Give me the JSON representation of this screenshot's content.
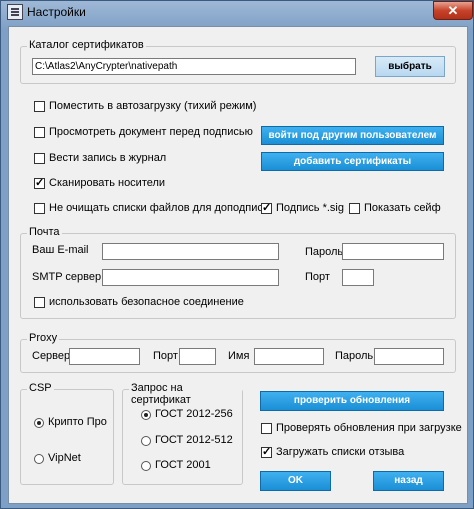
{
  "window": {
    "title": "Настройки",
    "close_glyph": "✕"
  },
  "catalog": {
    "group_title": "Каталог сертификатов",
    "path_value": "C:\\Atlas2\\AnyCrypter\\nativepath",
    "select_button": "выбрать"
  },
  "options": {
    "autostart": {
      "label": "Поместить в автозагрузку (тихий режим)",
      "checked": false
    },
    "preview": {
      "label": "Просмотреть документ перед подписью",
      "checked": false
    },
    "log": {
      "label": "Вести запись в журнал",
      "checked": false
    },
    "scan_media": {
      "label": "Сканировать носители",
      "checked": true
    },
    "keep_lists": {
      "label": "Не очищать списки файлов для доподписи",
      "checked": false
    },
    "signature_sig": {
      "label": "Подпись *.sig",
      "checked": true
    },
    "show_safe": {
      "label": "Показать сейф",
      "checked": false
    }
  },
  "buttons": {
    "login_other": "войти под другим пользователем",
    "add_certs": "добавить сертификаты",
    "check_updates": "проверить обновления",
    "ok": "OK",
    "back": "назад"
  },
  "mail": {
    "group_title": "Почта",
    "email_label": "Ваш E-mail",
    "email_value": "",
    "password_label": "Пароль",
    "password_value": "",
    "smtp_label": "SMTP сервер",
    "smtp_value": "",
    "port_label": "Порт",
    "port_value": "",
    "secure": {
      "label": "использовать безопасное соединение",
      "checked": false
    }
  },
  "proxy": {
    "group_title": "Proxy",
    "server_label": "Сервер",
    "server_value": "",
    "port_label": "Порт",
    "port_value": "",
    "name_label": "Имя",
    "name_value": "",
    "password_label": "Пароль",
    "password_value": ""
  },
  "csp": {
    "group_title": "CSP",
    "options": [
      {
        "label": "Крипто Про",
        "selected": true
      },
      {
        "label": "VipNet",
        "selected": false
      }
    ]
  },
  "cert_request": {
    "group_title": "Запрос на сертификат",
    "options": [
      {
        "label": "ГОСТ 2012-256",
        "selected": true
      },
      {
        "label": "ГОСТ 2012-512",
        "selected": false
      },
      {
        "label": "ГОСТ 2001",
        "selected": false
      }
    ]
  },
  "update_options": {
    "check_on_start": {
      "label": "Проверять обновления при загрузке",
      "checked": false
    },
    "load_revocation": {
      "label": "Загружать списки отзыва",
      "checked": true
    }
  },
  "colors": {
    "accent_button": "#1b8fd6",
    "title_bar": "#7fa0c6",
    "close_button": "#c7432a"
  }
}
